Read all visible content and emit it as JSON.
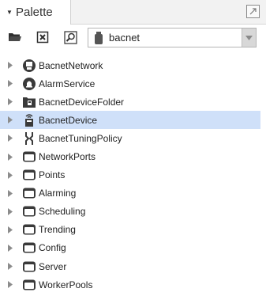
{
  "palette": {
    "title": "Palette",
    "collapse_icon": "caret-down-icon",
    "maximize_icon": "maximize-icon"
  },
  "toolbar": {
    "open_icon": "folder-open-icon",
    "close_icon": "close-box-icon",
    "find_icon": "find-icon",
    "module_icon": "jar-icon",
    "module_value": "bacnet",
    "dropdown_icon": "chevron-down-icon"
  },
  "tree": {
    "items": [
      {
        "label": "BacnetNetwork",
        "icon": "network-icon"
      },
      {
        "label": "AlarmService",
        "icon": "alarm-bell-icon"
      },
      {
        "label": "BacnetDeviceFolder",
        "icon": "device-folder-icon"
      },
      {
        "label": "BacnetDevice",
        "icon": "device-icon",
        "selected": true
      },
      {
        "label": "BacnetTuningPolicy",
        "icon": "tuning-policy-icon"
      },
      {
        "label": "NetworkPorts",
        "icon": "folder-icon"
      },
      {
        "label": "Points",
        "icon": "folder-icon"
      },
      {
        "label": "Alarming",
        "icon": "folder-icon"
      },
      {
        "label": "Scheduling",
        "icon": "folder-icon"
      },
      {
        "label": "Trending",
        "icon": "folder-icon"
      },
      {
        "label": "Config",
        "icon": "folder-icon"
      },
      {
        "label": "Server",
        "icon": "folder-icon"
      },
      {
        "label": "WorkerPools",
        "icon": "folder-icon"
      }
    ]
  },
  "colors": {
    "selection": "#cfe0f9",
    "icon_dark": "#333333",
    "expander": "#8c8c8c"
  }
}
